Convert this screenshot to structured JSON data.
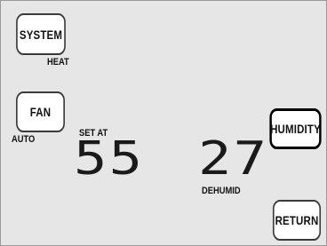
{
  "buttons": {
    "system": "SYSTEM",
    "fan": "FAN",
    "humidity": "HUMIDITY",
    "return": "RETURN"
  },
  "status": {
    "system_mode": "HEAT",
    "fan_mode": "AUTO",
    "set_at_label": "SET AT",
    "set_at_value": "55",
    "humidity_value": "27",
    "humidity_mode": "DEHUMID"
  },
  "colors": {
    "screen_background": "#e6e6e6",
    "button_background": "#ffffff",
    "text": "#111111"
  }
}
